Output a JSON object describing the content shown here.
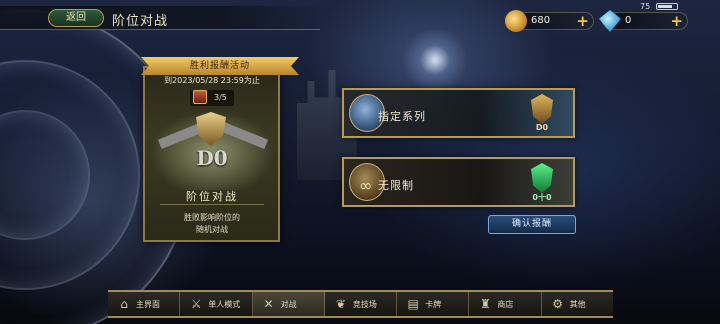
{
  "header": {
    "back_label": "返回",
    "title": "阶位对战"
  },
  "status_bar": {
    "battery": "75"
  },
  "resources": {
    "gold": {
      "value": "680",
      "plus": "+"
    },
    "gems": {
      "value": "0",
      "plus": "+"
    }
  },
  "event_card": {
    "ribbon": "胜利报酬活动",
    "date": "到2023/05/28 23:59为止",
    "progress": "3/5",
    "rank": "D0",
    "title": "阶位对战",
    "description_line1": "胜败影响阶位的",
    "description_line2": "随机对战"
  },
  "options": [
    {
      "label": "指定系列",
      "rank_label": "D0"
    },
    {
      "label": "无限制",
      "rank_label": "0十0"
    }
  ],
  "confirm_label": "确认报酬",
  "bottom_nav": [
    {
      "label": "主界面",
      "icon": "home-icon",
      "glyph": "⌂"
    },
    {
      "label": "单人模式",
      "icon": "sword-icon",
      "glyph": "⚔"
    },
    {
      "label": "对战",
      "icon": "crossed-swords-icon",
      "glyph": "✕"
    },
    {
      "label": "竞技场",
      "icon": "laurel-icon",
      "glyph": "❦"
    },
    {
      "label": "卡牌",
      "icon": "cards-icon",
      "glyph": "▤"
    },
    {
      "label": "商店",
      "icon": "shop-icon",
      "glyph": "♜"
    },
    {
      "label": "其他",
      "icon": "more-icon",
      "glyph": "⚙"
    }
  ],
  "active_nav_index": 2
}
